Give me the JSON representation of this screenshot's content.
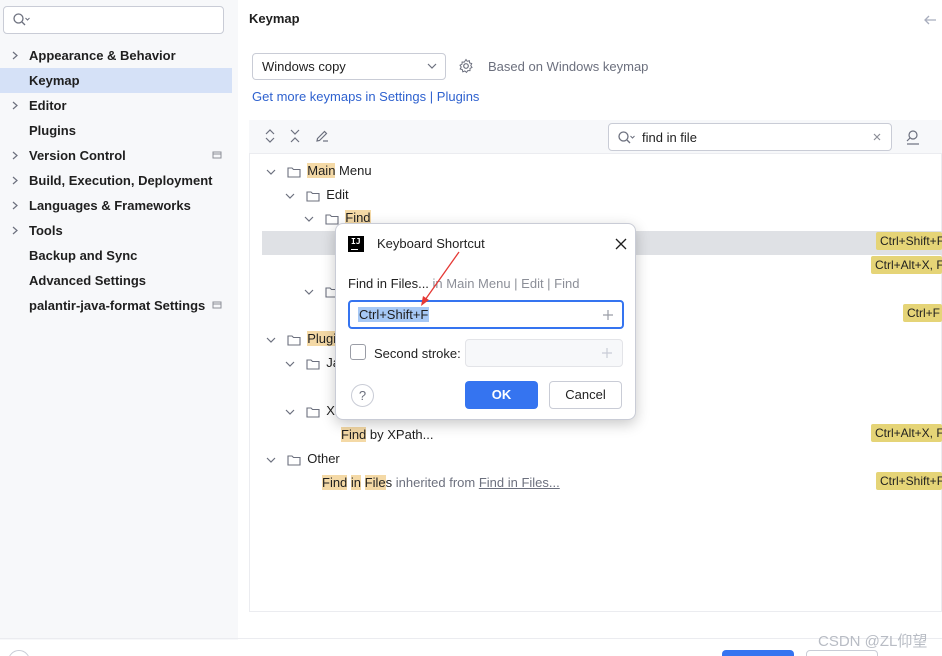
{
  "sidebar": {
    "search": {
      "value": "",
      "icon": "search-icon"
    },
    "items": [
      {
        "label": "Appearance & Behavior",
        "expandable": true
      },
      {
        "label": "Keymap",
        "expandable": false,
        "selected": true
      },
      {
        "label": "Editor",
        "expandable": true
      },
      {
        "label": "Plugins",
        "expandable": false
      },
      {
        "label": "Version Control",
        "expandable": true
      },
      {
        "label": "Build, Execution, Deployment",
        "expandable": true
      },
      {
        "label": "Languages & Frameworks",
        "expandable": true
      },
      {
        "label": "Tools",
        "expandable": true
      },
      {
        "label": "Backup and Sync",
        "expandable": false
      },
      {
        "label": "Advanced Settings",
        "expandable": false
      },
      {
        "label": "palantir-java-format Settings",
        "expandable": false
      }
    ]
  },
  "main": {
    "title": "Keymap",
    "keymap_select": "Windows copy",
    "based_on": "Based on Windows keymap",
    "link_keymaps": "Get more keymaps in Settings",
    "link_sep": "|",
    "link_plugins": "Plugins",
    "tree_search": "find in file",
    "tree": {
      "main_menu": {
        "hl": "Main",
        "rest": " Menu"
      },
      "edit": "Edit",
      "find": "Find",
      "plugins_prefix": "Plugi",
      "java_prefix": "Ja",
      "xpath_prefix": "XP",
      "find_by_xpath": {
        "hl": "Find",
        "rest": " by XPath..."
      },
      "other": "Other",
      "other_item": {
        "hl1": "Find",
        "sp1": " ",
        "hl2": "in",
        "sp2": " ",
        "hl3": "File",
        "rest": "s",
        "inherited": " inherited from ",
        "link": "Find in Files..."
      }
    },
    "shortcuts": [
      "Ctrl+Shift+F",
      "Ctrl+Alt+X, F",
      "Ctrl+F",
      "Ctrl+Alt+X, F",
      "Ctrl+Shift+F"
    ]
  },
  "dialog": {
    "title": "Keyboard Shortcut",
    "action_name": "Find in Files...",
    "action_path": " in Main Menu | Edit | Find",
    "shortcut_value": "Ctrl+Shift+F",
    "second_stroke_label": "Second stroke:",
    "second_stroke_checked": false,
    "help": "?",
    "ok": "OK",
    "cancel": "Cancel"
  },
  "watermark": "CSDN @ZL仰望",
  "colors": {
    "accent": "#3574f0",
    "selection": "#d5e1f7",
    "match_highlight": "#f4d9a6",
    "shortcut_chip": "#e5d477",
    "annotation_arrow": "#e53935"
  }
}
